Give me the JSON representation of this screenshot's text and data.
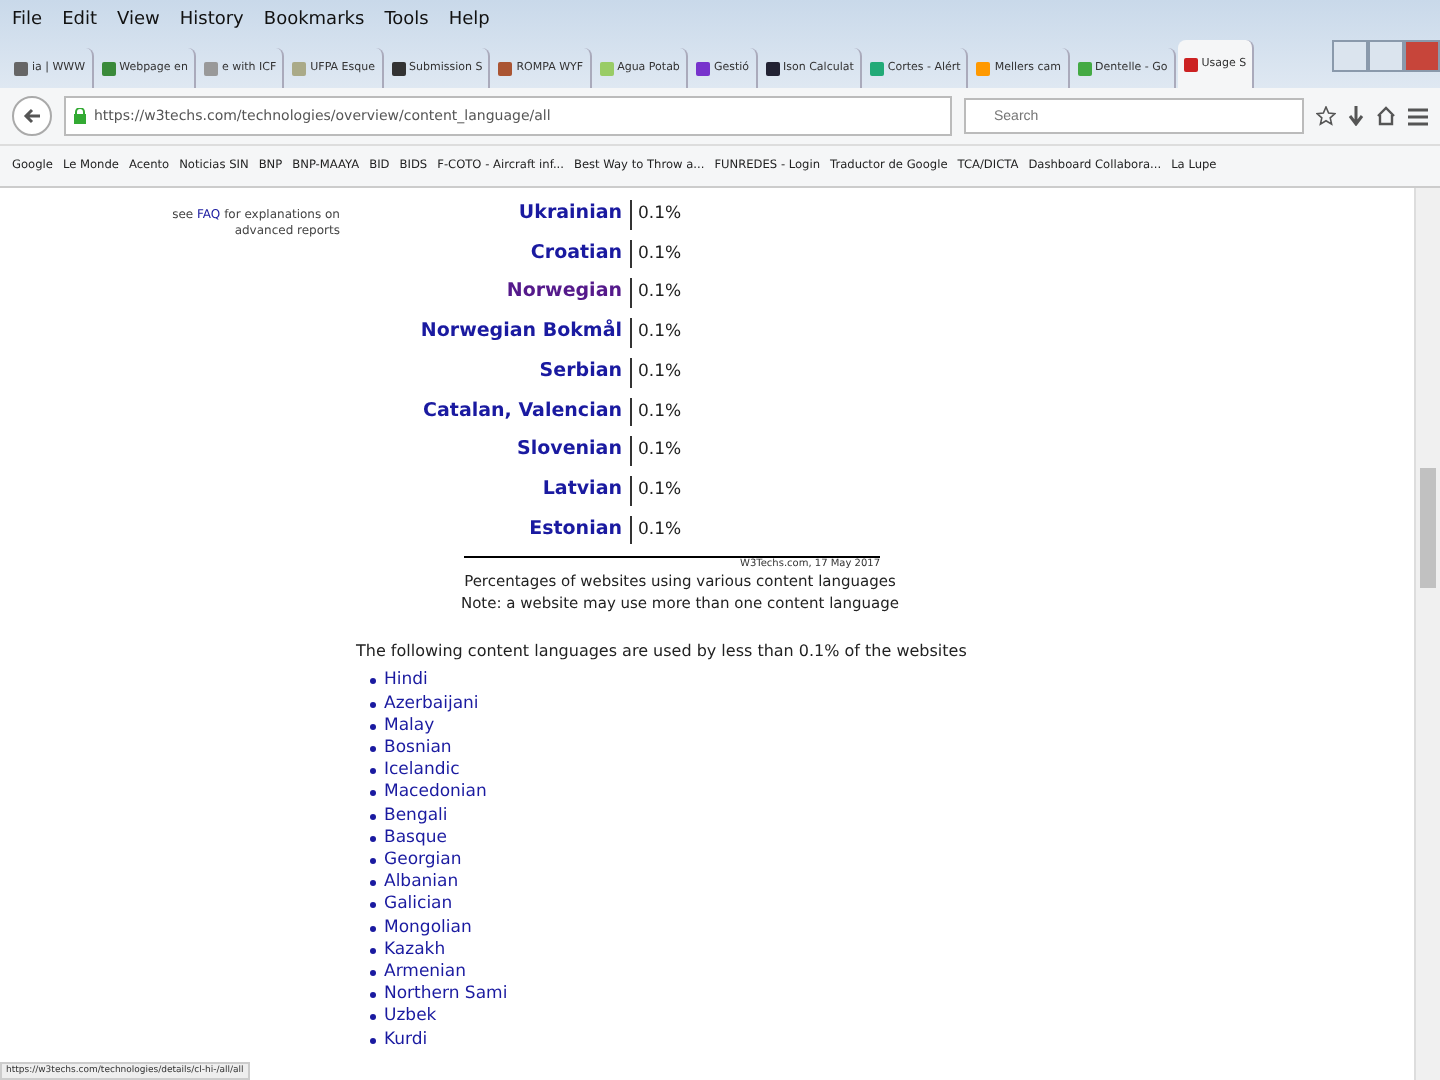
{
  "menu": [
    "File",
    "Edit",
    "View",
    "History",
    "Bookmarks",
    "Tools",
    "Help"
  ],
  "tabs": [
    {
      "label": "ia | WWW",
      "selected": false
    },
    {
      "label": "Webpage en",
      "selected": false
    },
    {
      "label": "e with ICF",
      "selected": false
    },
    {
      "label": "UFPA Esque",
      "selected": false
    },
    {
      "label": "Submission S",
      "selected": false
    },
    {
      "label": "ROMPA WYF",
      "selected": false
    },
    {
      "label": "Agua Potab",
      "selected": false
    },
    {
      "label": "Gestió",
      "selected": false
    },
    {
      "label": "Ison Calculat",
      "selected": false
    },
    {
      "label": "Cortes - Alért",
      "selected": false
    },
    {
      "label": "Mellers cam",
      "selected": false
    },
    {
      "label": "Dentelle - Go",
      "selected": false
    },
    {
      "label": "Usage S",
      "selected": true
    }
  ],
  "address": {
    "value": "https://w3techs.com/technologies/overview/content_language/all"
  },
  "search": {
    "placeholder": "Search"
  },
  "bookmarks": [
    "Google",
    "Le Monde",
    "Acento",
    "Noticias SIN",
    "BNP",
    "BNP-MAAYA",
    "BID",
    "BIDS",
    "F-COTO - Aircraft inf...",
    "Best Way to Throw a...",
    "FUNREDES - Login",
    "Traductor de Google",
    "TCA/DICTA",
    "Dashboard Collabora...",
    "La Lupe"
  ],
  "side_note": {
    "before": "see ",
    "link": "FAQ",
    "after": " for explanations on advanced reports"
  },
  "languages": [
    {
      "name": "Ukrainian",
      "value": "0.1%",
      "visited": false
    },
    {
      "name": "Croatian",
      "value": "0.1%",
      "visited": false
    },
    {
      "name": "Norwegian",
      "value": "0.1%",
      "visited": true
    },
    {
      "name": "Norwegian Bokmål",
      "value": "0.1%",
      "visited": false
    },
    {
      "name": "Serbian",
      "value": "0.1%",
      "visited": false
    },
    {
      "name": "Catalan, Valencian",
      "value": "0.1%",
      "visited": false
    },
    {
      "name": "Slovenian",
      "value": "0.1%",
      "visited": false
    },
    {
      "name": "Latvian",
      "value": "0.1%",
      "visited": false
    },
    {
      "name": "Estonian",
      "value": "0.1%",
      "visited": false
    }
  ],
  "credit": "W3Techs.com, 17 May 2017",
  "caption": [
    "Percentages of websites using various content languages",
    "Note: a website may use more than one content language"
  ],
  "paragraph": "The following content languages are used by less than 0.1% of the websites",
  "rare_languages": [
    "Hindi",
    "Azerbaijani",
    "Malay",
    "Bosnian",
    "Icelandic",
    "Macedonian",
    "Bengali",
    "Basque",
    "Georgian",
    "Albanian",
    "Galician",
    "Mongolian",
    "Kazakh",
    "Armenian",
    "Northern Sami",
    "Uzbek",
    "Kurdi"
  ],
  "status_url": "https://w3techs.com/technologies/details/cl-hi-/all/all"
}
